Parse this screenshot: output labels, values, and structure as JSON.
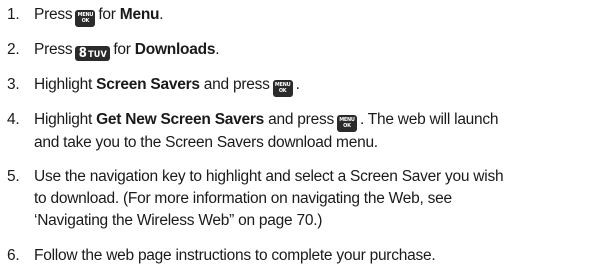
{
  "steps": [
    {
      "number": "1.",
      "parts": [
        "Press",
        "for",
        "Menu",
        "."
      ],
      "key": {
        "line1": "MENU",
        "line2": "OK"
      }
    },
    {
      "number": "2.",
      "parts": [
        "Press",
        "for",
        "Downloads",
        "."
      ],
      "key": {
        "digit": "8",
        "letters": "TUV"
      }
    },
    {
      "number": "3.",
      "parts": [
        "Highlight",
        "Screen Savers",
        "and press",
        "."
      ],
      "key": {
        "line1": "MENU",
        "line2": "OK"
      }
    },
    {
      "number": "4.",
      "parts": [
        "Highlight",
        "Get New Screen Savers",
        "and press",
        ". The web will launch",
        "and take you to the Screen Savers download menu."
      ],
      "key": {
        "line1": "MENU",
        "line2": "OK"
      }
    },
    {
      "number": "5.",
      "lines": [
        "Use the navigation key to highlight and select a Screen Saver you wish",
        "to download. (For more information on navigating the Web, see",
        "‘Navigating the Wireless Web” on page 70.)"
      ]
    },
    {
      "number": "6.",
      "text": "Follow the web page instructions to complete your purchase."
    }
  ]
}
